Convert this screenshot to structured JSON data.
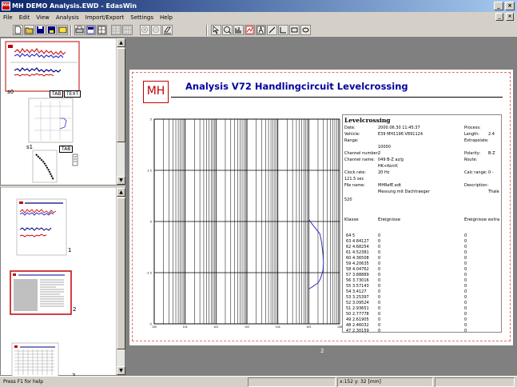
{
  "window": {
    "title": "MH DEMO Analysis.EWD - EdasWin",
    "minimize": "_",
    "maximize": "×"
  },
  "menu": [
    "File",
    "Edit",
    "View",
    "Analysis",
    "Import/Export",
    "Settings",
    "Help"
  ],
  "mdi_controls": [
    "_",
    "×"
  ],
  "toolbar_icons": [
    "new-icon",
    "open-icon",
    "save-icon",
    "save-as-icon",
    "export-icon",
    "print-icon",
    "layout-icon",
    "grid-icon",
    "table-icon",
    "table2-icon",
    "zoom-in-icon",
    "zoom-out-icon",
    "erase-icon",
    "select-icon",
    "zoom-icon",
    "bars-icon",
    "chart-icon",
    "text-icon",
    "line-icon",
    "corner-icon",
    "rectangle-icon",
    "ellipse-icon"
  ],
  "left_top": {
    "thumb_labels": {
      "s0": "s0",
      "s1": "s1"
    },
    "buttons": {
      "tab0": "TAB",
      "text0": "TEXT",
      "tab1": "TAB"
    }
  },
  "left_bottom": {
    "page_labels": [
      "1",
      "2",
      "3"
    ]
  },
  "document": {
    "logo": "MH",
    "title": "Analysis V72 Handlingcircuit Levelcrossing",
    "page_number": "2",
    "info": {
      "heading": "Levelcrossing",
      "fields": [
        {
          "label": "Date:",
          "value": "2000.06.30 11:45:37",
          "label2": "Process:",
          "value2": ""
        },
        {
          "label": "Vehicle:",
          "value": "E39 MH1196 V891124",
          "label2": "Length:",
          "value2": "2.4"
        },
        {
          "label": "Range:",
          "value": "",
          "label2": "Extrapolate:",
          "value2": ""
        },
        {
          "label": "",
          "value": "10000",
          "label2": "",
          "value2": ""
        },
        {
          "label": "Channel number:",
          "value": "2",
          "label2": "Polarity:",
          "value2": "B-Z"
        },
        {
          "label": "Channel name:",
          "value": "049 B-Z     az/g",
          "label2": "Route:",
          "value2": ""
        },
        {
          "label": "",
          "value": "HK+Kontf.",
          "label2": "",
          "value2": ""
        },
        {
          "label": "Clock rate:",
          "value": "20 Hz",
          "label2": "Calc range:",
          "value2": "0 -"
        },
        {
          "label": "121.5 sec",
          "value": "",
          "label2": "",
          "value2": ""
        },
        {
          "label": "File name:",
          "value": "MHRefE.edt",
          "label2": "Description:",
          "value2": ""
        },
        {
          "label": "",
          "value": "Messung mit Dachtraeger",
          "label2": "",
          "value2": "Thale"
        }
      ],
      "extra": "520",
      "table_headers": [
        "Klasse",
        "Ereignisse",
        "Ereignisse extra"
      ],
      "rows": [
        [
          "64",
          "5",
          "0",
          "0"
        ],
        [
          "63",
          "4.84127",
          "0",
          "0"
        ],
        [
          "62",
          "4.68254",
          "0",
          "0"
        ],
        [
          "61",
          "4.52381",
          "0",
          "0"
        ],
        [
          "60",
          "4.36508",
          "0",
          "0"
        ],
        [
          "59",
          "4.20635",
          "0",
          "0"
        ],
        [
          "58",
          "4.04762",
          "0",
          "0"
        ],
        [
          "57",
          "3.88889",
          "0",
          "0"
        ],
        [
          "56",
          "3.73016",
          "0",
          "0"
        ],
        [
          "55",
          "3.57143",
          "0",
          "0"
        ],
        [
          "54",
          "3.4127",
          "0",
          "0"
        ],
        [
          "53",
          "3.25397",
          "0",
          "0"
        ],
        [
          "52",
          "3.09524",
          "0",
          "0"
        ],
        [
          "51",
          "2.93651",
          "0",
          "0"
        ],
        [
          "50",
          "2.77778",
          "0",
          "0"
        ],
        [
          "49",
          "2.61905",
          "0",
          "0"
        ],
        [
          "48",
          "2.46032",
          "0",
          "0"
        ],
        [
          "47",
          "2.30159",
          "0",
          "0"
        ]
      ]
    }
  },
  "chart_data": {
    "type": "line",
    "title": "",
    "x_scale": "log",
    "xlim": [
      1,
      1000000
    ],
    "y_tick_labels": [
      "5",
      "2.5",
      "0",
      "-2.5",
      "-5"
    ],
    "ylim": [
      -5,
      5
    ],
    "grid": true,
    "series": [
      {
        "x": [
          100000,
          140000,
          230000,
          260000,
          290000,
          300000,
          290000,
          240000,
          200000,
          130000,
          100000
        ],
        "y": [
          0.1,
          -0.2,
          -0.6,
          -1.0,
          -1.6,
          -2.0,
          -2.4,
          -2.8,
          -3.0,
          -3.2,
          -3.3
        ]
      }
    ]
  },
  "status": {
    "help": "Press F1 for help",
    "coords": "x:152 y: 32 [mm]"
  },
  "colors": {
    "accent": "#c00000",
    "title_blue": "#0000a0",
    "workspace": "#808080",
    "series": "#3030c0"
  }
}
